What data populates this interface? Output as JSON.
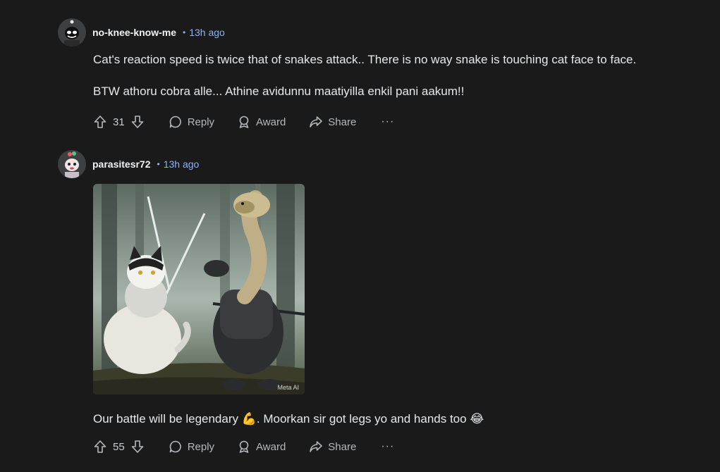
{
  "comments": [
    {
      "username": "no-knee-know-me",
      "separator": "•",
      "time": "13h ago",
      "paragraphs": [
        "Cat's reaction speed is twice that of snakes attack.. There is no way snake is touching cat face to face.",
        "BTW athoru cobra alle... Athine avidunnu maatiyilla enkil pani aakum!!"
      ],
      "votes": "31",
      "reply_label": "Reply",
      "award_label": "Award",
      "share_label": "Share",
      "more_label": "···"
    },
    {
      "username": "parasitesr72",
      "separator": "•",
      "time": "13h ago",
      "image_watermark": "Meta AI",
      "text_before_emoji": "Our battle will be legendary ",
      "emoji_1": "💪",
      "text_middle": ". Moorkan sir got legs yo and hands too ",
      "emoji_2": "😂",
      "votes": "55",
      "reply_label": "Reply",
      "award_label": "Award",
      "share_label": "Share",
      "more_label": "···"
    }
  ],
  "icons": {
    "upvote": "upvote-arrow-icon",
    "downvote": "downvote-arrow-icon",
    "reply": "speech-bubble-icon",
    "award": "award-ribbon-icon",
    "share": "share-arrow-icon",
    "more": "more-dots-icon"
  },
  "colors": {
    "background": "#1a1a1b",
    "username": "#f1f3f4",
    "timestamp": "#8ab4f8",
    "action": "#b5b8bb"
  }
}
